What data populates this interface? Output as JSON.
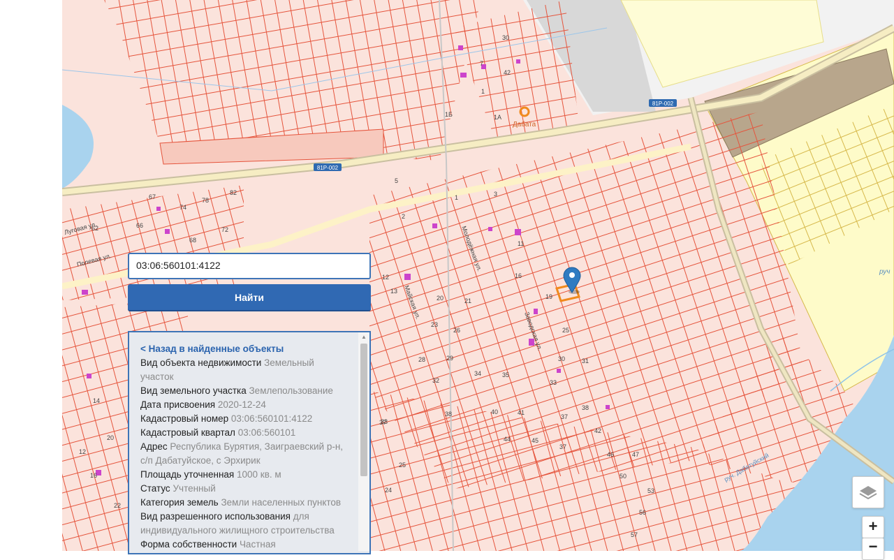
{
  "search": {
    "value": "03:06:560101:4122"
  },
  "find_button_label": "Найти",
  "info_panel": {
    "back_link": "< Назад в найденные объекты",
    "fields": [
      {
        "label": "Вид объекта недвижимости",
        "value": "Земельный участок"
      },
      {
        "label": "Вид земельного участка",
        "value": "Землепользование"
      },
      {
        "label": "Дата присвоения",
        "value": "2020-12-24"
      },
      {
        "label": "Кадастровый номер",
        "value": "03:06:560101:4122"
      },
      {
        "label": "Кадастровый квартал",
        "value": "03:06:560101"
      },
      {
        "label": "Адрес",
        "value": "Республика Бурятия, Заиграевский р-н, с/п Дабатуйское, с Эрхирик"
      },
      {
        "label": "Площадь уточненная",
        "value": "1000 кв. м"
      },
      {
        "label": "Статус",
        "value": "Учтенный"
      },
      {
        "label": "Категория земель",
        "value": "Земли населенных пунктов"
      },
      {
        "label": "Вид разрешенного использования",
        "value": "для индивидуального жилищного строительства"
      },
      {
        "label": "Форма собственности",
        "value": "Частная"
      }
    ]
  },
  "map": {
    "road_shields": [
      "81Р-002",
      "81Р-002"
    ],
    "poi_label": "Дабата",
    "street_labels": [
      "Луговая ул.",
      "Полевая ул.",
      "Заводская ул.",
      "Молодёжная ул.",
      "Майская ул.",
      "руч. Дабатуйский",
      "руч"
    ],
    "plot_numbers": [
      "30",
      "42",
      "7",
      "1",
      "1Б",
      "1А",
      "5",
      "2",
      "1",
      "3",
      "82",
      "78",
      "74",
      "67",
      "62",
      "66",
      "68",
      "72",
      "12",
      "13",
      "11",
      "16",
      "19",
      "25",
      "20",
      "21",
      "23",
      "26",
      "28",
      "29",
      "32",
      "34",
      "35",
      "30",
      "31",
      "33",
      "37",
      "38",
      "40",
      "41",
      "37",
      "38",
      "42",
      "44",
      "45",
      "37",
      "46",
      "47",
      "50",
      "53",
      "56",
      "57",
      "24",
      "25",
      "14",
      "20",
      "12",
      "16",
      "22",
      "33"
    ]
  },
  "controls": {
    "layers_icon": "layers-icon",
    "zoom_in": "+",
    "zoom_out": "−"
  },
  "colors": {
    "parcel_line": "#e5543c",
    "parcel_fill": "#fbe3dc",
    "accent": "#3069b3",
    "marker": "#2f7bc1",
    "selected_parcel": "#f08a1e"
  }
}
